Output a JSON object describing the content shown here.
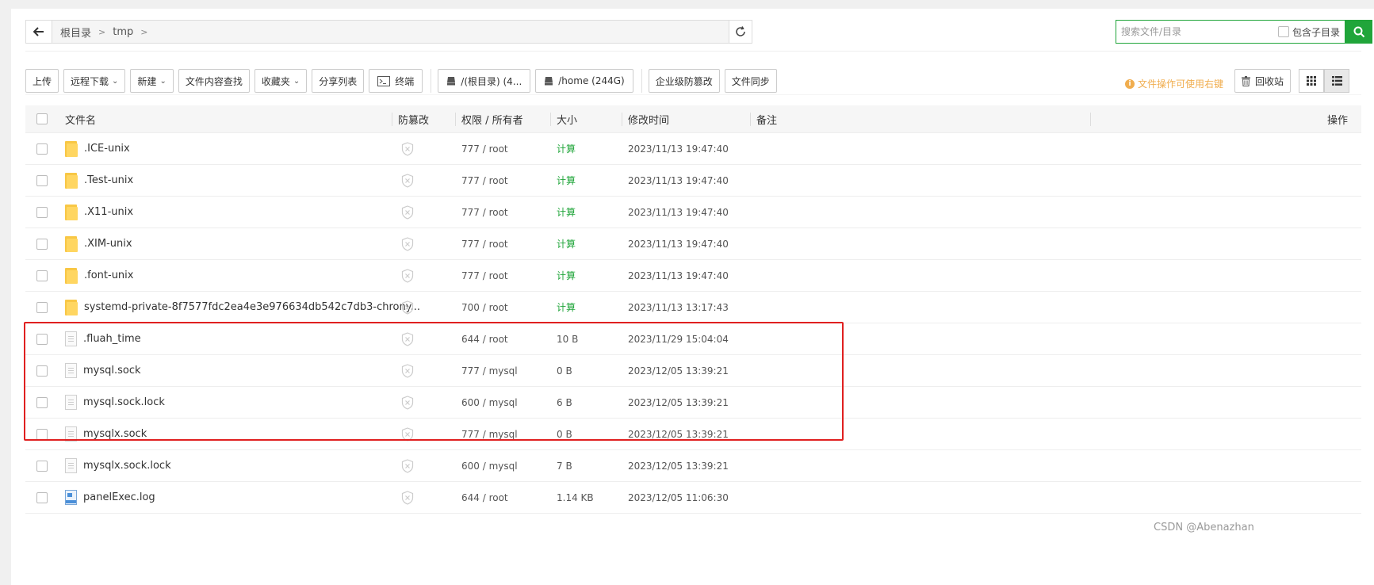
{
  "path": {
    "crumbs": [
      "根目录",
      "tmp"
    ]
  },
  "search": {
    "placeholder": "搜索文件/目录",
    "subdir_label": "包含子目录"
  },
  "toolbar": {
    "upload": "上传",
    "remote_download": "远程下载",
    "new": "新建",
    "content_search": "文件内容查找",
    "favorites": "收藏夹",
    "share_list": "分享列表",
    "terminal": "终端",
    "disk_root": "/(根目录) (4...",
    "disk_home": "/home (244G)",
    "tamper": "企业级防篡改",
    "sync": "文件同步"
  },
  "tip": "文件操作可使用右键",
  "recycle_label": "回收站",
  "table": {
    "headers": {
      "name": "文件名",
      "protect": "防篡改",
      "perm": "权限 / 所有者",
      "size": "大小",
      "time": "修改时间",
      "note": "备注",
      "ops": "操作"
    },
    "rows": [
      {
        "type": "folder",
        "name": ".ICE-unix",
        "perm": "777 / root",
        "size": "计算",
        "time": "2023/11/13 19:47:40"
      },
      {
        "type": "folder",
        "name": ".Test-unix",
        "perm": "777 / root",
        "size": "计算",
        "time": "2023/11/13 19:47:40"
      },
      {
        "type": "folder",
        "name": ".X11-unix",
        "perm": "777 / root",
        "size": "计算",
        "time": "2023/11/13 19:47:40"
      },
      {
        "type": "folder",
        "name": ".XIM-unix",
        "perm": "777 / root",
        "size": "计算",
        "time": "2023/11/13 19:47:40"
      },
      {
        "type": "folder",
        "name": ".font-unix",
        "perm": "777 / root",
        "size": "计算",
        "time": "2023/11/13 19:47:40"
      },
      {
        "type": "folder",
        "name": "systemd-private-8f7577fdc2ea4e3e976634db542c7db3-chrony...",
        "perm": "700 / root",
        "size": "计算",
        "time": "2023/11/13 13:17:43"
      },
      {
        "type": "file",
        "name": ".fluah_time",
        "perm": "644 / root",
        "size": "10 B",
        "time": "2023/11/29 15:04:04"
      },
      {
        "type": "file",
        "name": "mysql.sock",
        "perm": "777 / mysql",
        "size": "0 B",
        "time": "2023/12/05 13:39:21"
      },
      {
        "type": "file",
        "name": "mysql.sock.lock",
        "perm": "600 / mysql",
        "size": "6 B",
        "time": "2023/12/05 13:39:21"
      },
      {
        "type": "file",
        "name": "mysqlx.sock",
        "perm": "777 / mysql",
        "size": "0 B",
        "time": "2023/12/05 13:39:21"
      },
      {
        "type": "file",
        "name": "mysqlx.sock.lock",
        "perm": "600 / mysql",
        "size": "7 B",
        "time": "2023/12/05 13:39:21"
      },
      {
        "type": "log",
        "name": "panelExec.log",
        "perm": "644 / root",
        "size": "1.14 KB",
        "time": "2023/12/05 11:06:30"
      }
    ]
  },
  "watermark": "CSDN @Abenazhan",
  "colors": {
    "accent": "#20a53a",
    "highlight": "#e02020",
    "warning": "#f0ad4e"
  }
}
